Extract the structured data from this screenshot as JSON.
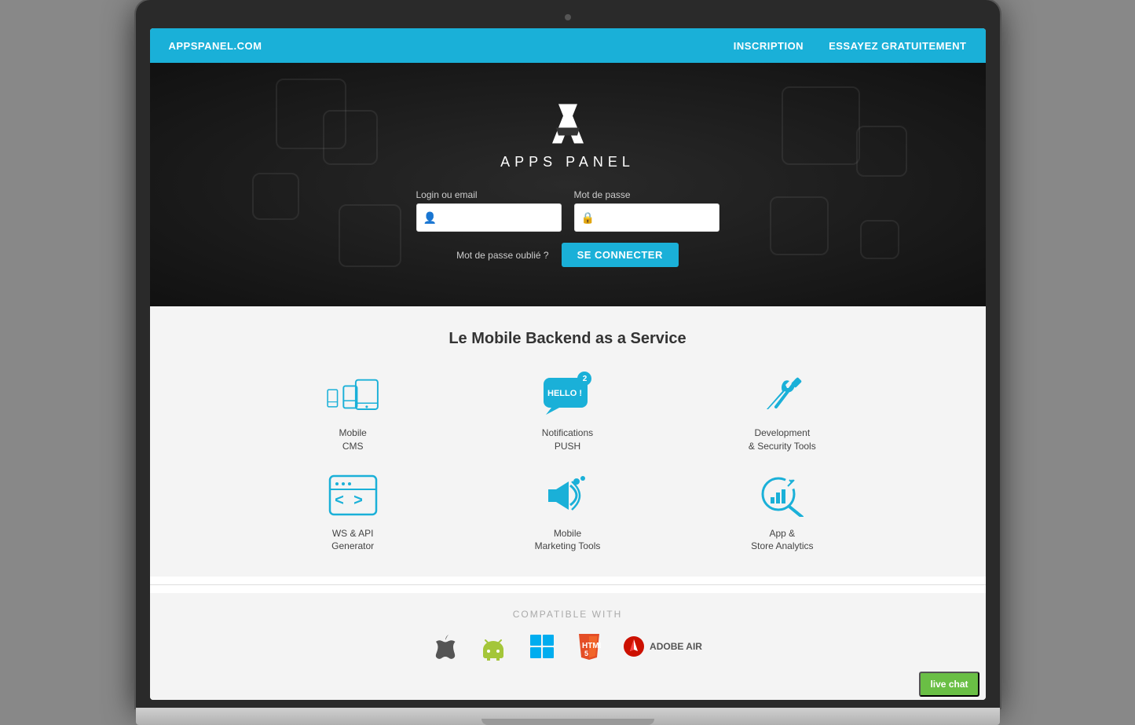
{
  "topnav": {
    "logo": "APPSPANEL.COM",
    "inscription": "INSCRIPTION",
    "trial": "ESSAYEZ GRATUITEMENT"
  },
  "hero": {
    "logo_text": "APPS PANEL",
    "login_label": "Login ou email",
    "password_label": "Mot de passe",
    "login_placeholder": "",
    "password_placeholder": "",
    "forgot_text": "Mot de passe oublié ?",
    "connect_btn": "SE CONNECTER"
  },
  "features": {
    "title": "Le Mobile Backend as a Service",
    "items": [
      {
        "label": "Mobile\nCMS",
        "icon": "mobile-cms"
      },
      {
        "label": "Notifications\nPUSH",
        "icon": "notifications-push",
        "badge": "2"
      },
      {
        "label": "Development\n& Security Tools",
        "icon": "dev-security"
      },
      {
        "label": "WS & API\nGenerator",
        "icon": "ws-api"
      },
      {
        "label": "Mobile\nMarketing Tools",
        "icon": "marketing"
      },
      {
        "label": "App &\nStore Analytics",
        "icon": "analytics"
      }
    ]
  },
  "compatible": {
    "title": "COMPATIBLE WITH",
    "platforms": [
      "Apple",
      "Android",
      "Windows",
      "HTML5",
      "Adobe AIR"
    ]
  },
  "livechat": {
    "label": "live chat"
  }
}
